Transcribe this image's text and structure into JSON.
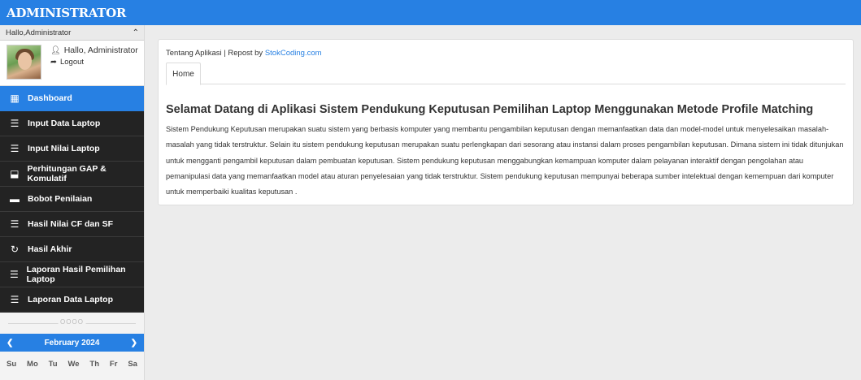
{
  "header": {
    "brand": "ADMINISTRATOR",
    "bar_color": "#2780e3"
  },
  "sidebar": {
    "greeting": "Hallo,Administrator",
    "user_name": "Hallo, Administrator",
    "logout_label": "Logout",
    "menu": [
      {
        "label": "Dashboard",
        "icon": "dashboard-icon",
        "active": true
      },
      {
        "label": "Input Data Laptop",
        "icon": "list-icon"
      },
      {
        "label": "Input Nilai Laptop",
        "icon": "list-icon"
      },
      {
        "label": "Perhitungan GAP & Komulatif",
        "icon": "archive-icon"
      },
      {
        "label": "Bobot Penilaian",
        "icon": "comment-icon"
      },
      {
        "label": "Hasil Nilai CF dan SF",
        "icon": "list-icon"
      },
      {
        "label": "Hasil Akhir",
        "icon": "refresh-icon"
      },
      {
        "label": "Laporan Hasil Pemilihan Laptop",
        "icon": "list-icon"
      },
      {
        "label": "Laporan Data Laptop",
        "icon": "list-icon"
      }
    ],
    "separator": "OOOO",
    "calendar": {
      "month": "February 2024",
      "weekdays": [
        "Su",
        "Mo",
        "Tu",
        "We",
        "Th",
        "Fr",
        "Sa"
      ]
    }
  },
  "main": {
    "crumb_text": "Tentang Aplikasi | Repost by ",
    "crumb_link": "StokCoding.com",
    "tab_home": "Home",
    "title": "Selamat Datang di Aplikasi Sistem Pendukung Keputusan Pemilihan Laptop Menggunakan Metode Profile Matching",
    "description": "Sistem Pendukung Keputusan merupakan suatu sistem yang berbasis komputer yang membantu pengambilan keputusan dengan memanfaatkan data dan model-model untuk menyelesaikan masalah-masalah yang tidak terstruktur. Selain itu sistem pendukung keputusan merupakan suatu perlengkapan dari sesorang atau instansi dalam proses pengambilan keputusan. Dimana sistem ini tidak ditunjukan untuk mengganti pengambil keputusan dalam pembuatan keputusan. Sistem pendukung keputusan menggabungkan kemampuan komputer dalam pelayanan interaktif dengan pengolahan atau pemanipulasi data yang memanfaatkan model atau aturan penyelesaian yang tidak terstruktur. Sistem pendukung keputusan mempunyai beberapa sumber intelektual dengan kemempuan dari komputer untuk memperbaiki kualitas keputusan ."
  }
}
